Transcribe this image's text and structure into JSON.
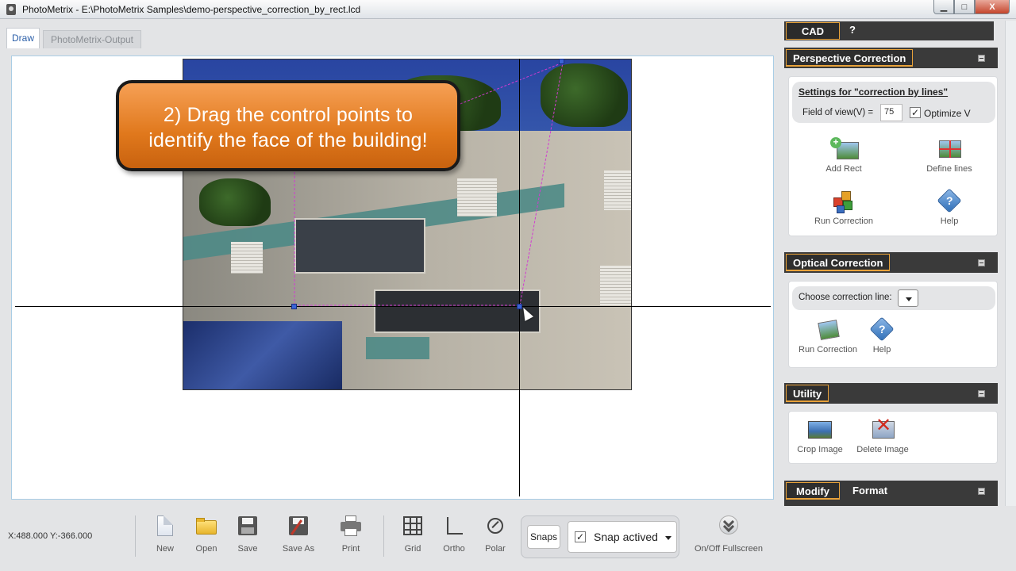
{
  "window": {
    "title": "PhotoMetrix - E:\\PhotoMetrix Samples\\demo-perspective_correction_by_rect.lcd",
    "minimize": "▁",
    "maximize": "□",
    "close": "X"
  },
  "tabs": [
    {
      "label": "Draw",
      "active": true
    },
    {
      "label": "PhotoMetrix-Output",
      "active": false
    }
  ],
  "canvas": {
    "callout_line1": "2) Drag the control points to",
    "callout_line2": "identify the face of the building!"
  },
  "rightpanel": {
    "top_tabs": {
      "cad": "CAD",
      "help": "?"
    },
    "perspective": {
      "title": "Perspective Correction",
      "settings_title": "Settings for \"correction by lines\"",
      "fov_label": "Field of view(V) =",
      "fov_value": "75",
      "optimize_label": "Optimize V",
      "optimize_checked": "✓",
      "tools": [
        "Add Rect",
        "Define lines",
        "Run Correction",
        "Help"
      ]
    },
    "optical": {
      "title": "Optical Correction",
      "choose_label": "Choose correction line:",
      "tools": [
        "Run Correction",
        "Help"
      ]
    },
    "utility": {
      "title": "Utility",
      "tools": [
        "Crop Image",
        "Delete Image"
      ]
    },
    "modify": {
      "title": "Modify",
      "format": "Format"
    }
  },
  "bottombar": {
    "coords": "X:488.000 Y:-366.000",
    "tools": [
      "New",
      "Open",
      "Save",
      "Save As",
      "Print",
      "Grid",
      "Ortho",
      "Polar"
    ],
    "snaps_label": "Snaps",
    "snap_active_label": "Snap actived",
    "snap_checked": "✓",
    "fullscreen_label": "On/Off Fullscreen"
  },
  "colors": {
    "accent_orange": "#e8a23a",
    "callout_orange": "#e0781c",
    "panel_dark": "#3a3a3a",
    "control_point": "#3b64d6",
    "guide_line": "#d23ad2"
  }
}
